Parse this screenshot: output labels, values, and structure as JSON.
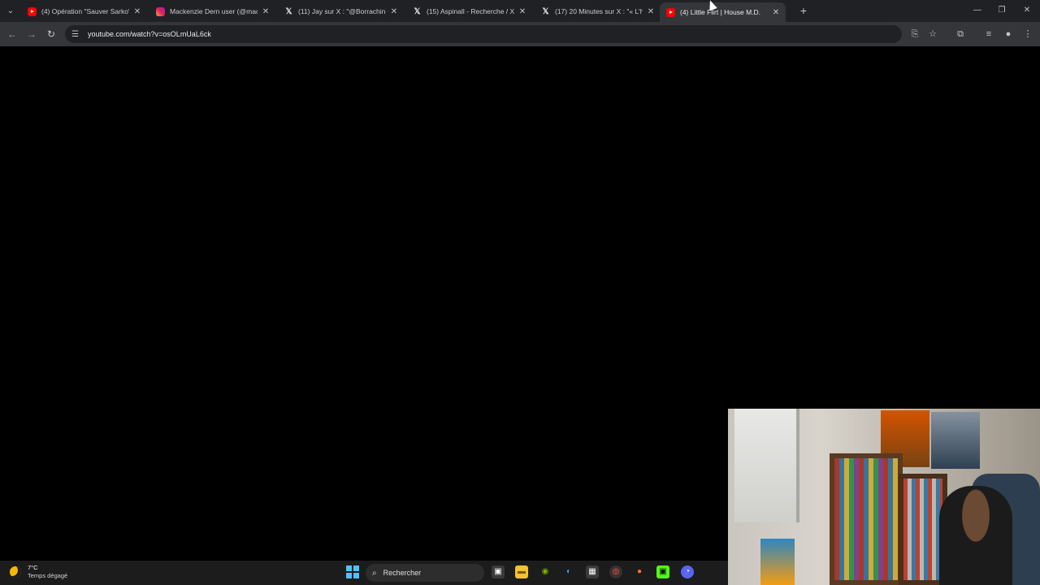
{
  "tabs": [
    {
      "title": "(4) Opération \"Sauver Sarko\", l",
      "icon": "youtube-icon",
      "active": false
    },
    {
      "title": "Mackenzie Dern user (@macke",
      "icon": "instagram-icon",
      "active": false
    },
    {
      "title": "(11) Jay sur X : \"@Borrachinha",
      "icon": "x-icon",
      "active": false
    },
    {
      "title": "(15) Aspinall - Recherche / X",
      "icon": "x-icon",
      "active": false
    },
    {
      "title": "(17) 20 Minutes sur X : \"« L'hu",
      "icon": "x-icon",
      "active": false
    },
    {
      "title": "(4) Little Flirt | House M.D.",
      "icon": "youtube-icon",
      "active": true
    }
  ],
  "address_bar": {
    "url": "youtube.com/watch?v=osOLmUaL6ck"
  },
  "taskbar": {
    "weather_temp": "7°C",
    "weather_cond": "Temps dégagé",
    "search_text": "Rechercher"
  },
  "colors": {
    "accent": "#4cc2ff",
    "chrome_dark": "#202124",
    "chrome_toolbar": "#35363a"
  }
}
